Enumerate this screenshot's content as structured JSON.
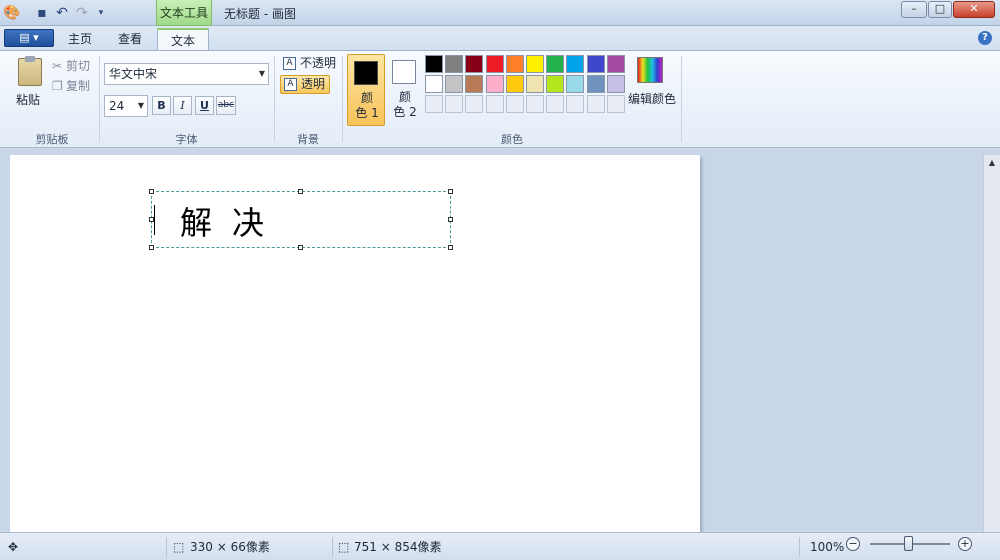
{
  "window": {
    "title": "无标题 - 画图",
    "contextual_tab": "文本工具",
    "controls": [
      "–",
      "□",
      "✕"
    ]
  },
  "quick_access": [
    "paint-app-icon",
    "save-icon",
    "undo-icon",
    "redo-icon",
    "customize-icon"
  ],
  "app_menu": {
    "label": "▤ ▾"
  },
  "tabs": [
    {
      "label": "主页",
      "active": false
    },
    {
      "label": "查看",
      "active": false
    },
    {
      "label": "文本",
      "active": true
    }
  ],
  "ribbon": {
    "clipboard": {
      "paste": "粘贴",
      "cut": "剪切",
      "copy": "复制",
      "group_label": "剪贴板"
    },
    "font": {
      "family": "华文中宋",
      "size": "24",
      "bold": "B",
      "italic": "I",
      "underline": "U",
      "strikethrough": "abc",
      "group_label": "字体"
    },
    "background": {
      "opaque": "不透明",
      "transparent": "透明",
      "group_label": "背景"
    },
    "colors": {
      "color1_label": "颜\n色 1",
      "color1": "#000000",
      "color2_label": "颜\n色 2",
      "color2": "#ffffff",
      "edit_label": "编辑颜色",
      "group_label": "颜色",
      "palette_row1": [
        "#000000",
        "#7f7f7f",
        "#880015",
        "#ed1c24",
        "#ff7f27",
        "#fff200",
        "#22b14c",
        "#00a2e8",
        "#3f48cc",
        "#a349a4"
      ],
      "palette_row2": [
        "#ffffff",
        "#c3c3c3",
        "#b97a57",
        "#ffaec9",
        "#ffc90e",
        "#efe4b0",
        "#b5e61d",
        "#99d9ea",
        "#7092be",
        "#c8bfe7"
      ]
    }
  },
  "canvas": {
    "text_content": "解决"
  },
  "status": {
    "selection_size": "330 × 66像素",
    "canvas_size": "751 × 854像素",
    "zoom": "100%"
  }
}
